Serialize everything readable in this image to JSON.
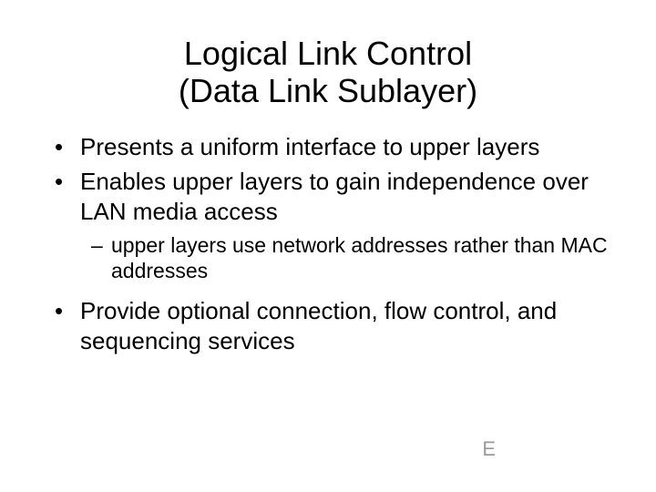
{
  "title_line1": "Logical Link Control",
  "title_line2": "(Data Link Sublayer)",
  "bullets": {
    "b1": "Presents a uniform interface to upper layers",
    "b2": "Enables upper layers to gain independence over LAN media access",
    "b2_sub1": "upper layers use network addresses rather than MAC addresses",
    "b3": "Provide optional connection, flow control, and sequencing services"
  },
  "footer": "E"
}
